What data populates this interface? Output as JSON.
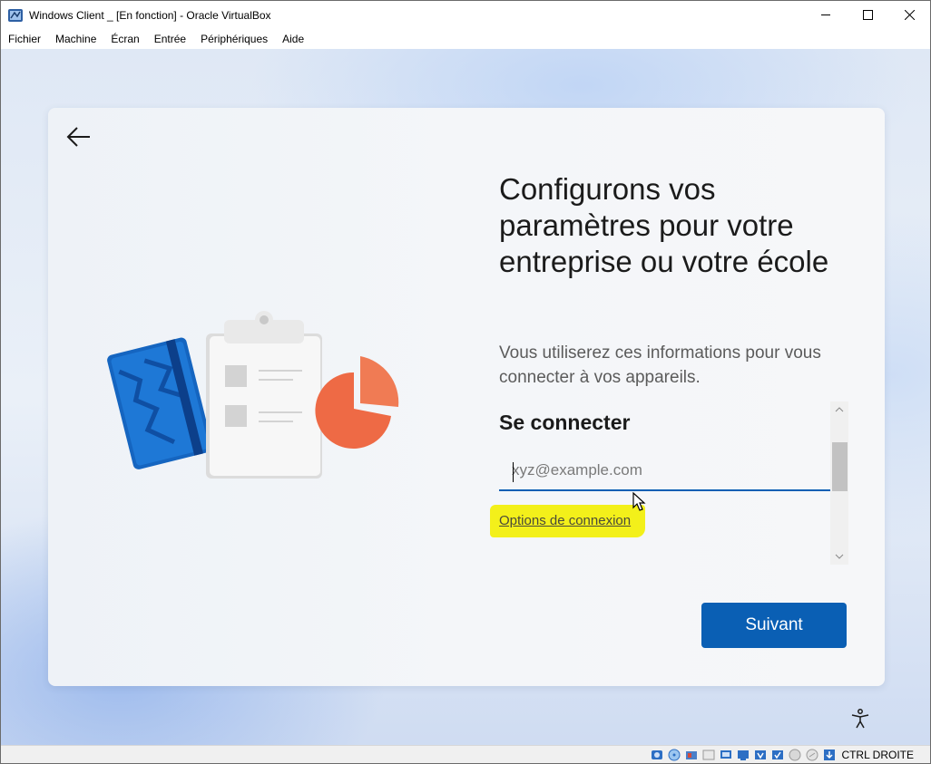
{
  "window": {
    "title": "Windows Client _ [En fonction] - Oracle VirtualBox",
    "controls": [
      "minimize",
      "maximize",
      "close"
    ]
  },
  "menubar": {
    "items": [
      "Fichier",
      "Machine",
      "Écran",
      "Entrée",
      "Périphériques",
      "Aide"
    ]
  },
  "setup": {
    "heading": "Configurons vos paramètres pour votre entreprise ou votre école",
    "subtext": "Vous utiliserez ces informations pour vous connecter à vos appareils.",
    "signin_title": "Se connecter",
    "email_placeholder": "xyz@example.com",
    "email_value": "",
    "options_link": "Options de connexion",
    "next_label": "Suivant"
  },
  "statusbar": {
    "host_key": "CTRL DROITE",
    "icons": [
      "hard-disk-icon",
      "optical-drive-icon",
      "audio-icon",
      "network-icon",
      "usb-icon",
      "shared-folders-icon",
      "display-icon",
      "recording-icon",
      "cpu-icon",
      "mouse-integration-icon",
      "keyboard-capture-icon"
    ]
  },
  "colors": {
    "accent": "#0a5fb4",
    "highlight": "#f3f01a"
  }
}
